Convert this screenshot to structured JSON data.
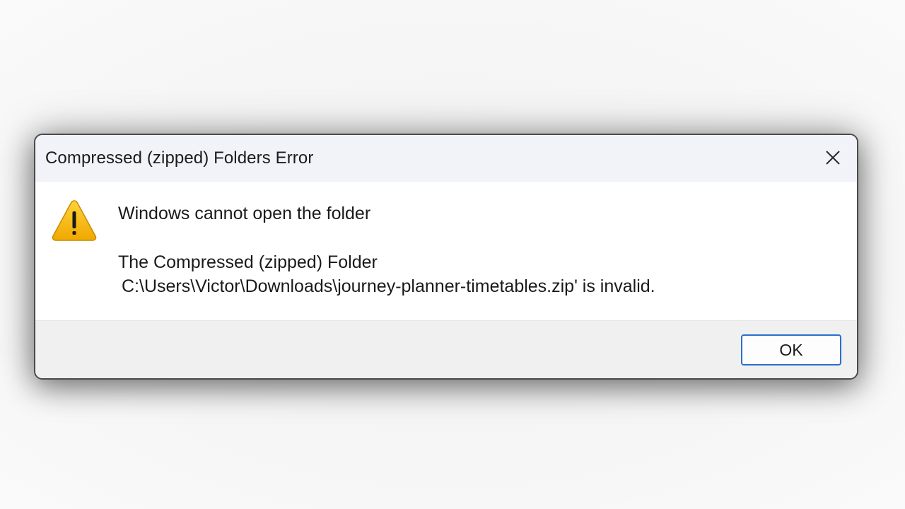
{
  "dialog": {
    "title": "Compressed (zipped) Folders Error",
    "close_icon": "close-icon",
    "icon": "warning-icon",
    "heading": "Windows cannot open the folder",
    "message_line1": "The Compressed (zipped) Folder",
    "message_line2": "C:\\Users\\Victor\\Downloads\\journey-planner-timetables.zip' is invalid.",
    "ok_label": "OK"
  },
  "colors": {
    "warning_fill": "#f5b800",
    "button_border": "#2a6fc9",
    "titlebar_bg": "#f1f3f9",
    "footer_bg": "#f0f0f0"
  }
}
